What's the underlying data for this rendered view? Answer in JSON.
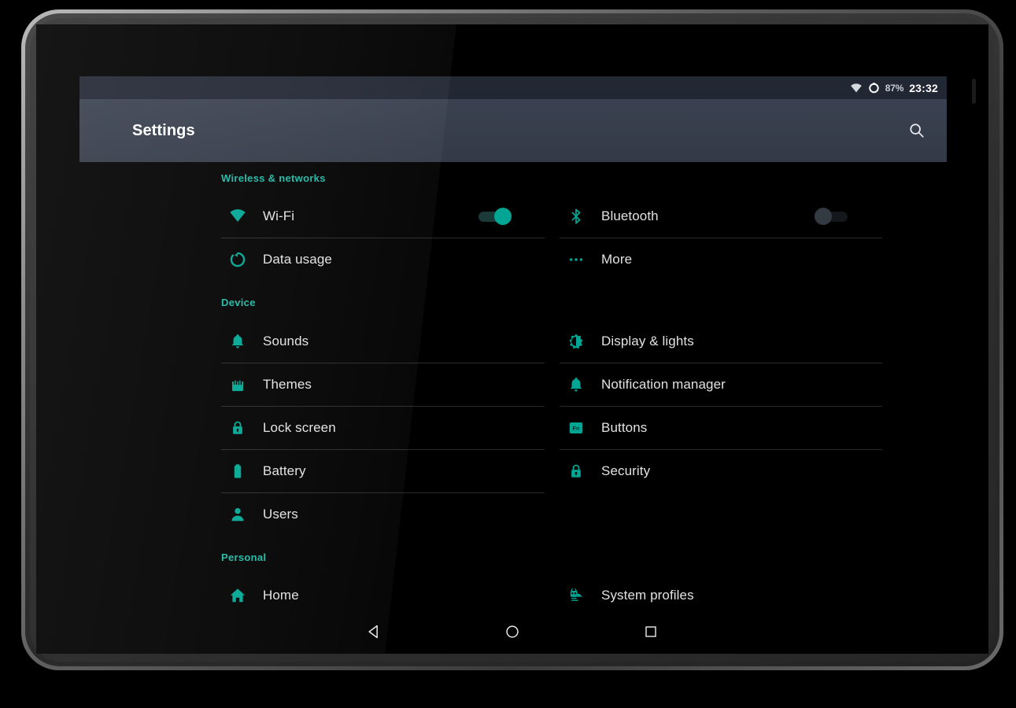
{
  "status_bar": {
    "wifi_icon": "wifi-icon",
    "battery_icon": "battery-circle-icon",
    "battery_percent": "87%",
    "clock": "23:32"
  },
  "action_bar": {
    "title": "Settings",
    "search_icon": "search-icon"
  },
  "colors": {
    "accent": "#00a693",
    "section_header": "#1fb7a4",
    "action_bar": "#333a47",
    "status_bar": "#222734",
    "background": "#000000",
    "label": "#e2e2e2",
    "divider": "#2a2a2a",
    "toggle_off_thumb": "#343a42"
  },
  "sections": [
    {
      "title": "Wireless & networks",
      "left_items": [
        {
          "label": "Wi-Fi",
          "icon": "wifi-icon",
          "toggle": "on"
        },
        {
          "label": "Data usage",
          "icon": "data-usage-icon",
          "toggle": null
        }
      ],
      "right_items": [
        {
          "label": "Bluetooth",
          "icon": "bluetooth-icon",
          "toggle": "off"
        },
        {
          "label": "More",
          "icon": "more-dots-icon",
          "toggle": null
        }
      ]
    },
    {
      "title": "Device",
      "left_items": [
        {
          "label": "Sounds",
          "icon": "bell-icon",
          "toggle": null
        },
        {
          "label": "Themes",
          "icon": "themes-icon",
          "toggle": null
        },
        {
          "label": "Lock screen",
          "icon": "lock-icon",
          "toggle": null
        },
        {
          "label": "Battery",
          "icon": "battery-icon",
          "toggle": null
        },
        {
          "label": "Users",
          "icon": "person-icon",
          "toggle": null
        }
      ],
      "right_items": [
        {
          "label": "Display & lights",
          "icon": "brightness-icon",
          "toggle": null
        },
        {
          "label": "Notification manager",
          "icon": "bell-icon",
          "toggle": null
        },
        {
          "label": "Buttons",
          "icon": "fn-key-icon",
          "toggle": null
        },
        {
          "label": "Security",
          "icon": "lock-icon",
          "toggle": null
        }
      ]
    },
    {
      "title": "Personal",
      "left_items": [
        {
          "label": "Home",
          "icon": "home-icon",
          "toggle": null
        }
      ],
      "right_items": [
        {
          "label": "System profiles",
          "icon": "cid-robot-icon",
          "toggle": null
        }
      ]
    }
  ],
  "nav_bar": {
    "back": "back-triangle-icon",
    "home": "home-circle-icon",
    "recents": "recents-square-icon"
  }
}
